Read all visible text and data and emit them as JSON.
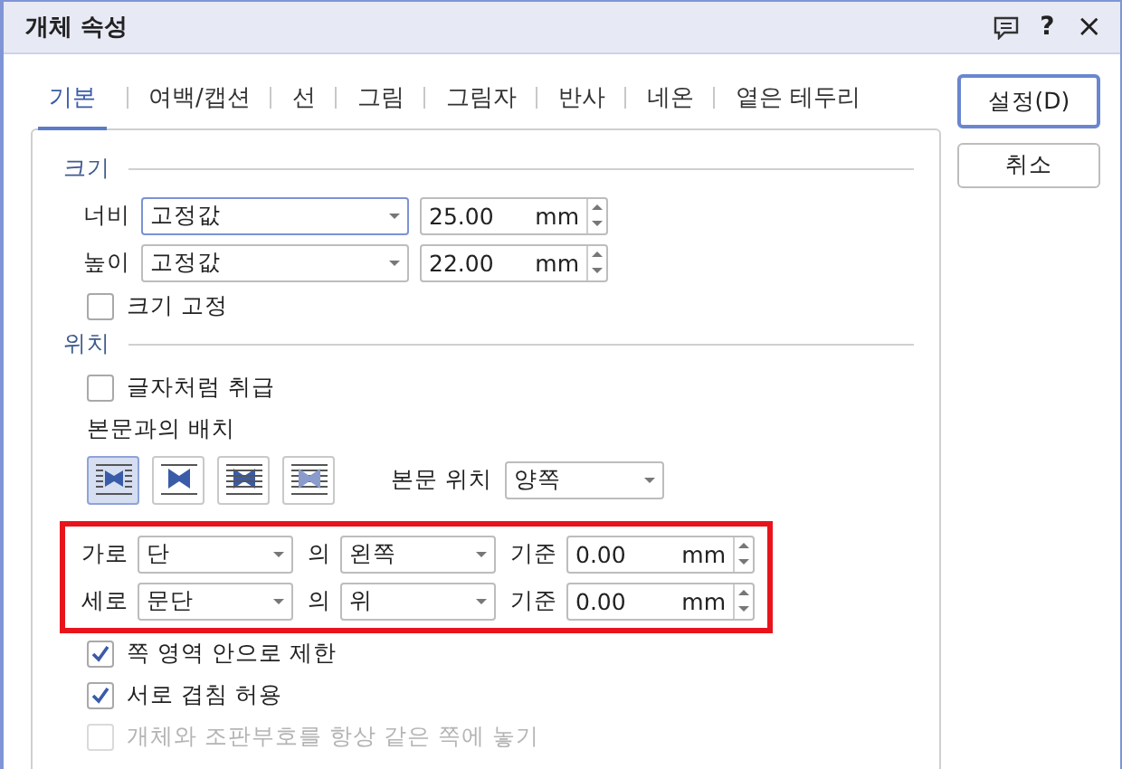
{
  "window": {
    "title": "개체 속성",
    "help": "?",
    "close": "×"
  },
  "tabs": [
    {
      "label": "기본",
      "selected": true
    },
    {
      "label": "여백/캡션",
      "selected": false
    },
    {
      "label": "선",
      "selected": false
    },
    {
      "label": "그림",
      "selected": false
    },
    {
      "label": "그림자",
      "selected": false
    },
    {
      "label": "반사",
      "selected": false
    },
    {
      "label": "네온",
      "selected": false
    },
    {
      "label": "옅은 테두리",
      "selected": false
    }
  ],
  "buttons": [
    {
      "label": "설정(D)",
      "default": true
    },
    {
      "label": "취소",
      "default": false
    }
  ],
  "size": {
    "title": "크기",
    "rows": [
      {
        "label": "너비",
        "mode": "고정값",
        "value": "25.00",
        "unit": "mm"
      },
      {
        "label": "높이",
        "mode": "고정값",
        "value": "22.00",
        "unit": "mm"
      }
    ],
    "lock": {
      "label": "크기 고정",
      "checked": false
    }
  },
  "position": {
    "title": "위치",
    "treat_as_char": {
      "label": "글자처럼 취급",
      "checked": false
    },
    "wrap_label": "본문과의 배치",
    "wrap_options": [
      {
        "kind": "square",
        "selected": true
      },
      {
        "kind": "top-bottom",
        "selected": false
      },
      {
        "kind": "behind",
        "selected": false
      },
      {
        "kind": "front",
        "selected": false
      }
    ],
    "text_pos": {
      "label": "본문 위치",
      "value": "양쪽"
    },
    "offsets": [
      {
        "label": "가로",
        "base": "단",
        "of": "의",
        "anchor": "왼쪽",
        "ref": "기준",
        "value": "0.00",
        "unit": "mm"
      },
      {
        "label": "세로",
        "base": "문단",
        "of": "의",
        "anchor": "위",
        "ref": "기준",
        "value": "0.00",
        "unit": "mm"
      }
    ],
    "options": [
      {
        "label": "쪽 영역 안으로 제한",
        "checked": true,
        "disabled": false
      },
      {
        "label": "서로 겹침 허용",
        "checked": true,
        "disabled": false
      },
      {
        "label": "개체와 조판부호를 항상 같은 쪽에 놓기",
        "checked": false,
        "disabled": true
      }
    ]
  }
}
